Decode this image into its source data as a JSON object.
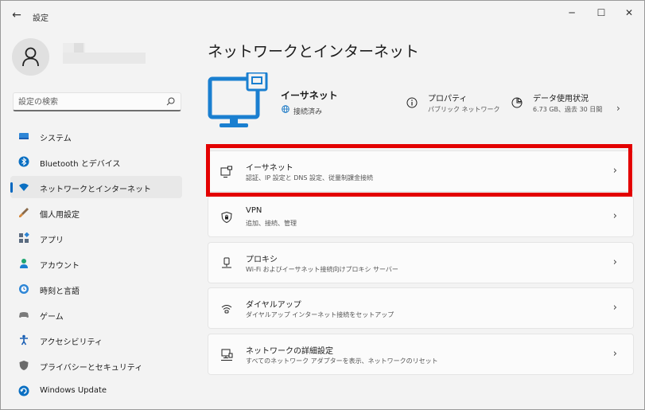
{
  "window": {
    "title": "設定",
    "back_glyph": "←",
    "minimize_glyph": "─",
    "maximize_glyph": "☐",
    "close_glyph": "✕"
  },
  "search": {
    "placeholder": "設定の検索"
  },
  "sidebar": {
    "items": [
      {
        "label": "システム",
        "icon": "system-icon",
        "color": "#0a6fc2"
      },
      {
        "label": "Bluetooth とデバイス",
        "icon": "bluetooth-icon",
        "color": "#0a6fc2"
      },
      {
        "label": "ネットワークとインターネット",
        "icon": "wifi-icon",
        "color": "#0a6fc2",
        "active": true
      },
      {
        "label": "個人用設定",
        "icon": "brush-icon",
        "color": "#c8753b"
      },
      {
        "label": "アプリ",
        "icon": "apps-icon",
        "color": "#5a6b80"
      },
      {
        "label": "アカウント",
        "icon": "account-icon",
        "color": "#1ea672"
      },
      {
        "label": "時刻と言語",
        "icon": "globe-clock-icon",
        "color": "#0a6fc2"
      },
      {
        "label": "ゲーム",
        "icon": "gamepad-icon",
        "color": "#7a7a7a"
      },
      {
        "label": "アクセシビリティ",
        "icon": "accessibility-icon",
        "color": "#1a5fb4"
      },
      {
        "label": "プライバシーとセキュリティ",
        "icon": "shield-icon",
        "color": "#6b6b6b"
      },
      {
        "label": "Windows Update",
        "icon": "update-icon",
        "color": "#0a6fc2"
      }
    ]
  },
  "main": {
    "title": "ネットワークとインターネット",
    "hero": {
      "name": "イーサネット",
      "status": "接続済み",
      "properties": {
        "title": "プロパティ",
        "sub": "パブリック ネットワーク"
      },
      "data_usage": {
        "title": "データ使用状況",
        "sub": "6.73 GB、過去 30 日間"
      },
      "chevron": "›"
    },
    "cards": [
      {
        "title": "イーサネット",
        "sub": "認証、IP 設定と DNS 設定、従量制課金接続",
        "icon": "ethernet-icon"
      },
      {
        "title": "VPN",
        "sub": "追加、接続、管理",
        "icon": "vpn-shield-icon"
      },
      {
        "title": "プロキシ",
        "sub": "Wi-Fi およびイーサネット接続向けプロキシ サーバー",
        "icon": "proxy-icon"
      },
      {
        "title": "ダイヤルアップ",
        "sub": "ダイヤルアップ インターネット接続をセットアップ",
        "icon": "dialup-icon"
      },
      {
        "title": "ネットワークの詳細設定",
        "sub": "すべてのネットワーク アダプターを表示、ネットワークのリセット",
        "icon": "network-advanced-icon"
      }
    ],
    "chevron": "›"
  },
  "colors": {
    "accent": "#0067c0",
    "highlight": "#e30000"
  }
}
